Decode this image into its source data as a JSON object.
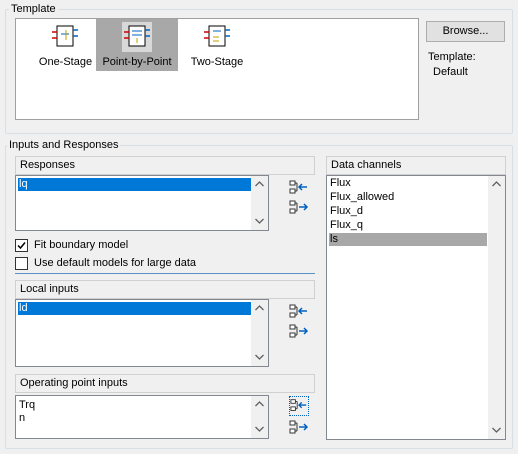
{
  "template_group": {
    "title": "Template",
    "items": [
      {
        "label": "One-Stage",
        "icon": "one-stage-template-icon"
      },
      {
        "label": "Point-by-Point",
        "icon": "point-by-point-template-icon",
        "selected": true
      },
      {
        "label": "Two-Stage",
        "icon": "two-stage-template-icon"
      }
    ],
    "browse_label": "Browse...",
    "template_caption": "Template:",
    "template_value": "Default"
  },
  "inputs_group": {
    "title": "Inputs and Responses",
    "responses": {
      "header": "Responses",
      "items": [
        "lq"
      ],
      "selected_index": 0
    },
    "fit_boundary": {
      "label": "Fit boundary model",
      "checked": true
    },
    "use_default_models": {
      "label": "Use default models for large data",
      "checked": false
    },
    "local_inputs": {
      "header": "Local inputs",
      "items": [
        "ld"
      ],
      "selected_index": 0
    },
    "operating_point_inputs": {
      "header": "Operating point inputs",
      "items": [
        "Trq",
        "n"
      ]
    },
    "data_channels": {
      "header": "Data channels",
      "items": [
        "Flux",
        "Flux_allowed",
        "Flux_d",
        "Flux_q",
        "ls"
      ],
      "highlighted_index": 4
    }
  },
  "colors": {
    "selection_blue": "#0078d7",
    "selection_grey": "#a8a8a8",
    "window_bg": "#f0f0f0"
  }
}
